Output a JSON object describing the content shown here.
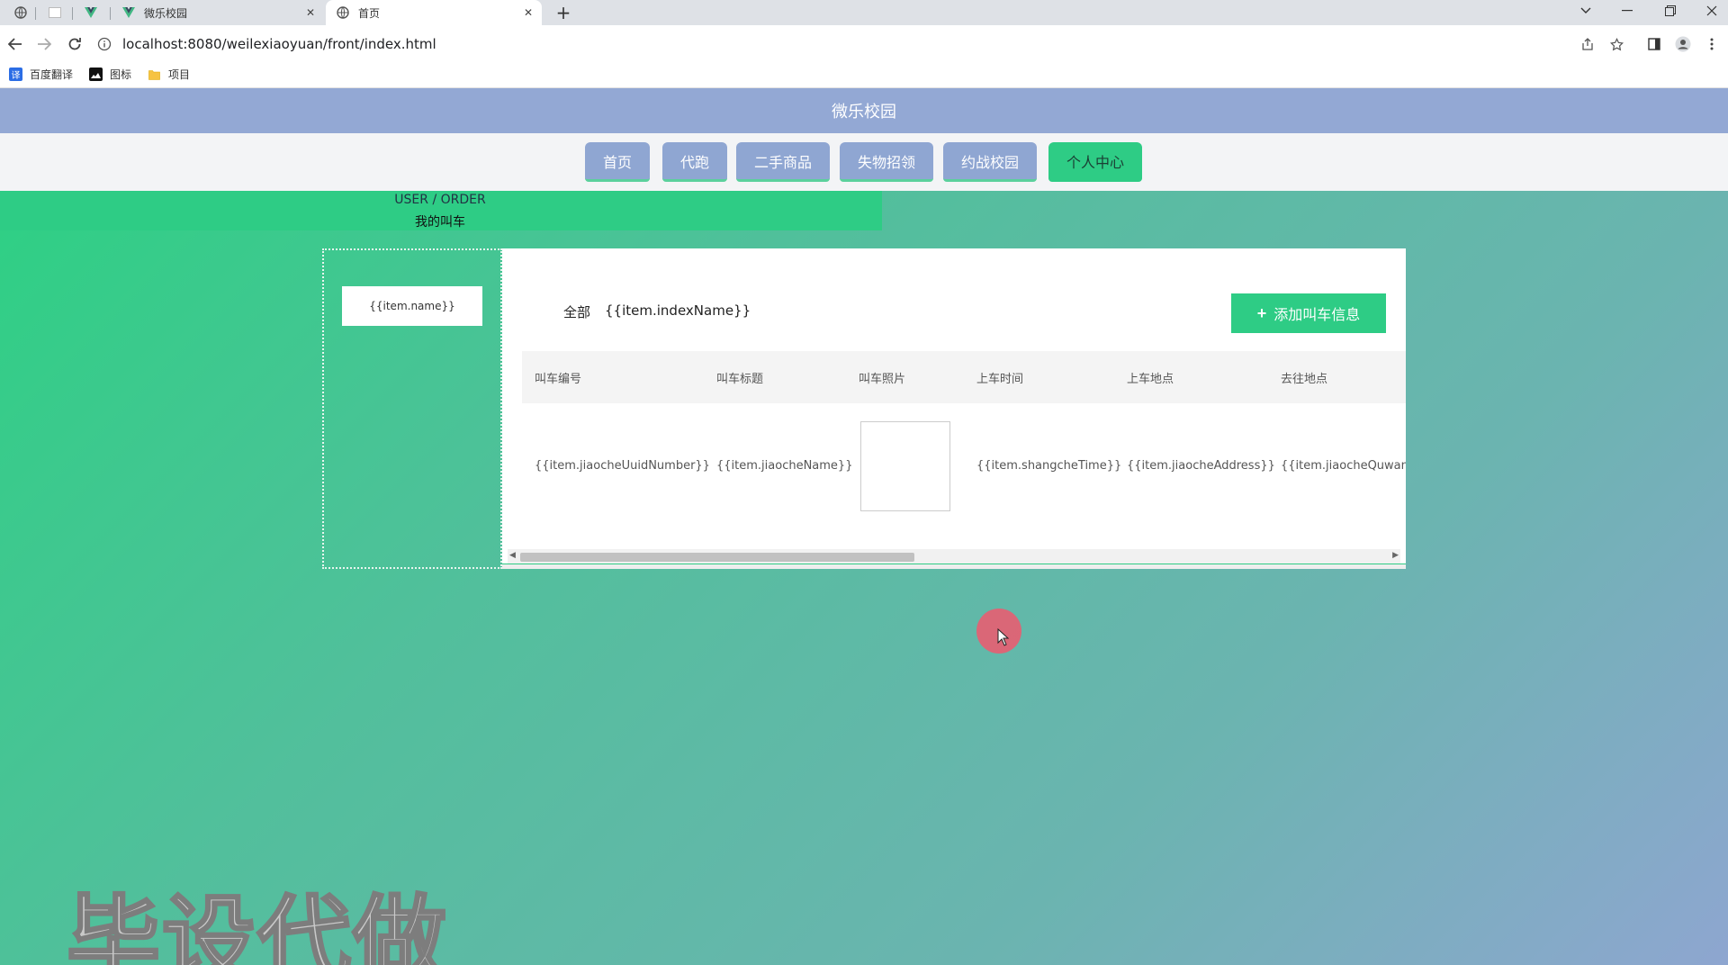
{
  "browser": {
    "tabs": [
      {
        "title": "微乐校园",
        "icon": "vue-logo-icon"
      },
      {
        "title": "首页",
        "icon": "globe-icon"
      }
    ],
    "close_glyph": "✕",
    "newtab_glyph": "+",
    "url": "localhost:8080/weilexiaoyuan/front/index.html",
    "bookmarks": [
      "百度翻译",
      "图标",
      "项目"
    ]
  },
  "site": {
    "title": "微乐校园",
    "nav": [
      "首页",
      "代跑",
      "二手商品",
      "失物招领",
      "约战校园",
      "个人中心"
    ],
    "active_nav": "个人中心"
  },
  "breadcrumb": {
    "line1": "USER / ORDER",
    "line2": "我的叫车"
  },
  "sidebar": {
    "item": "{{item.name}}"
  },
  "filter": {
    "all": "全部",
    "index": "{{item.indexName}}"
  },
  "add_button": {
    "plus": "+",
    "label": "添加叫车信息"
  },
  "table": {
    "headers": [
      "叫车编号",
      "叫车标题",
      "叫车照片",
      "上车时间",
      "上车地点",
      "去往地点"
    ],
    "row": [
      "{{item.jiaocheUuidNumber}}",
      "{{item.jiaocheName}}",
      "",
      "{{item.shangcheTime}}",
      "{{item.jiaocheAddress}}",
      "{{item.jiaocheQuwang"
    ]
  },
  "watermark": "毕设代做",
  "colors": {
    "accent_green": "#2ecc85",
    "header_blue": "#93a8d4"
  }
}
